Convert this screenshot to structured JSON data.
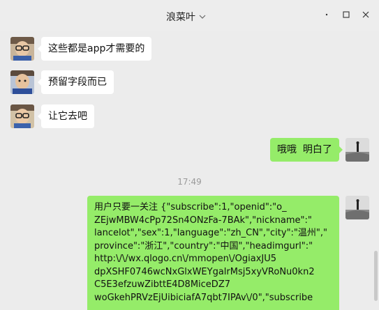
{
  "window": {
    "title": "浪菜叶",
    "title_dropdown_icon": "chevron-down-icon",
    "controls": [
      "pin-icon",
      "minimize-icon",
      "maximize-icon",
      "close-icon"
    ]
  },
  "messages": [
    {
      "side": "left",
      "text": "这些都是app才需要的"
    },
    {
      "side": "left",
      "text": "预留字段而已"
    },
    {
      "side": "left",
      "text": "让它去吧"
    },
    {
      "side": "right",
      "text": "哦哦  明白了"
    }
  ],
  "timestamp": "17:49",
  "long_message": {
    "lines": [
      "用户只要一关注  {\"subscribe\":1,\"openid\":\"o_",
      "ZEjwMBW4cPp72Sn4ONzFa-7BAk\",\"nickname\":\"",
      "lancelot\",\"sex\":1,\"language\":\"zh_CN\",\"city\":\"温州\",\"",
      "province\":\"浙江\",\"country\":\"中国\",\"headimgurl\":\"",
      "http:\\/\\/wx.qlogo.cn\\/mmopen\\/OgiaxJU5",
      "dpXSHF0746wcNxGlxWEYgalrMsj5xyVRoNu0kn2",
      "C5E3efzuwZibttE4D8MiceDZ7",
      "woGkehPRVzEjUibiciafA7qbt7IPAv\\/0\",\"subscribe"
    ]
  },
  "colors": {
    "background": "#ececec",
    "self_bubble": "#95ec69",
    "other_bubble": "#ffffff"
  }
}
